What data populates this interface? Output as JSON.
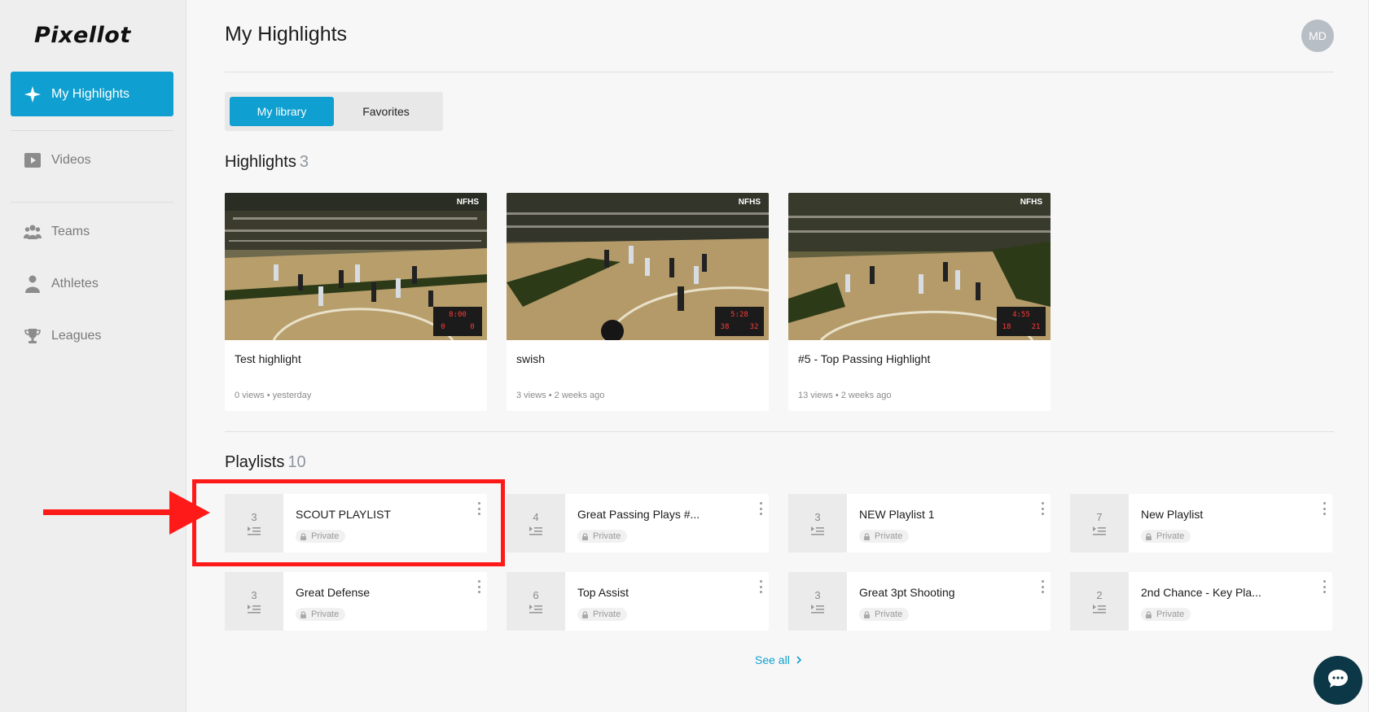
{
  "brand": {
    "logo": "Pixellot",
    "accent": "#0f9fd0"
  },
  "sidebar": {
    "active": {
      "label": "My Highlights",
      "icon": "sparkle-icon"
    },
    "items": [
      {
        "label": "Videos",
        "icon": "video-icon"
      },
      {
        "label": "Teams",
        "icon": "teams-icon"
      },
      {
        "label": "Athletes",
        "icon": "athlete-icon"
      },
      {
        "label": "Leagues",
        "icon": "trophy-icon"
      }
    ]
  },
  "header": {
    "title": "My Highlights",
    "avatar_initials": "MD"
  },
  "tabs": [
    {
      "label": "My library"
    },
    {
      "label": "Favorites"
    }
  ],
  "highlights": {
    "title": "Highlights",
    "count": "3",
    "items": [
      {
        "title": "Test highlight",
        "meta": "0 views • yesterday",
        "watermark": "NFHS",
        "score_clock": "8:00",
        "score_home": "0",
        "score_away": "0"
      },
      {
        "title": "swish",
        "meta": "3 views • 2 weeks ago",
        "watermark": "NFHS",
        "score_clock": "5:28",
        "score_home": "38",
        "score_away": "32"
      },
      {
        "title": "#5 - Top Passing Highlight",
        "meta": "13 views • 2 weeks ago",
        "watermark": "NFHS",
        "score_clock": "4:55",
        "score_home": "18",
        "score_away": "21"
      }
    ]
  },
  "playlists": {
    "title": "Playlists",
    "count": "10",
    "items": [
      {
        "count": "3",
        "name": "SCOUT PLAYLIST",
        "privacy": "Private"
      },
      {
        "count": "4",
        "name": "Great Passing Plays #...",
        "privacy": "Private"
      },
      {
        "count": "3",
        "name": "NEW Playlist 1",
        "privacy": "Private"
      },
      {
        "count": "7",
        "name": "New Playlist",
        "privacy": "Private"
      },
      {
        "count": "3",
        "name": "Great Defense",
        "privacy": "Private"
      },
      {
        "count": "6",
        "name": "Top Assist",
        "privacy": "Private"
      },
      {
        "count": "3",
        "name": "Great 3pt Shooting",
        "privacy": "Private"
      },
      {
        "count": "2",
        "name": "2nd Chance - Key Pla...",
        "privacy": "Private"
      }
    ],
    "see_all": "See all"
  }
}
